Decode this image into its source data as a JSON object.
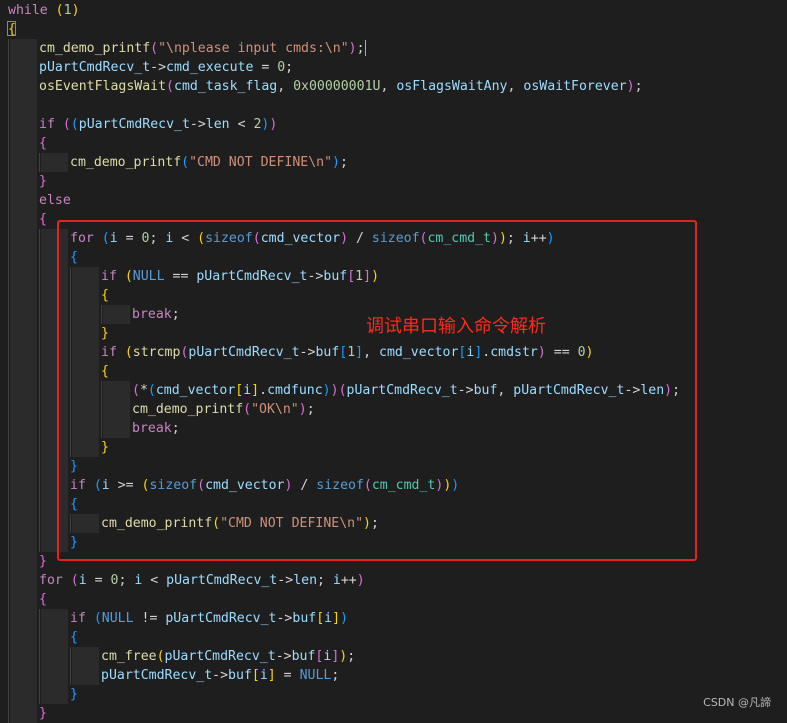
{
  "editor": {
    "lines": [
      {
        "indent": 0,
        "tokens": [
          [
            "kw",
            "while"
          ],
          [
            "pn",
            " "
          ],
          [
            "b1",
            "("
          ],
          [
            "num",
            "1"
          ],
          [
            "b1",
            ")"
          ]
        ]
      },
      {
        "indent": 0,
        "tokens": [
          [
            "b1",
            "{"
          ]
        ]
      },
      {
        "indent": 1,
        "cursor": true,
        "tokens": [
          [
            "fn",
            "cm_demo_printf"
          ],
          [
            "b2",
            "("
          ],
          [
            "str",
            "\"\\nplease input cmds:\\n\""
          ],
          [
            "b2",
            ")"
          ],
          [
            "pn",
            ";"
          ]
        ]
      },
      {
        "indent": 1,
        "tokens": [
          [
            "var",
            "pUartCmdRecv_t"
          ],
          [
            "pn",
            "->"
          ],
          [
            "var",
            "cmd_execute"
          ],
          [
            "pn",
            " = "
          ],
          [
            "num",
            "0"
          ],
          [
            "pn",
            ";"
          ]
        ]
      },
      {
        "indent": 1,
        "tokens": [
          [
            "fn",
            "osEventFlagsWait"
          ],
          [
            "b2",
            "("
          ],
          [
            "var",
            "cmd_task_flag"
          ],
          [
            "pn",
            ", "
          ],
          [
            "num",
            "0x00000001U"
          ],
          [
            "pn",
            ", "
          ],
          [
            "var",
            "osFlagsWaitAny"
          ],
          [
            "pn",
            ", "
          ],
          [
            "var",
            "osWaitForever"
          ],
          [
            "b2",
            ")"
          ],
          [
            "pn",
            ";"
          ]
        ]
      },
      {
        "indent": 1,
        "tokens": []
      },
      {
        "indent": 1,
        "tokens": [
          [
            "kw",
            "if"
          ],
          [
            "pn",
            " "
          ],
          [
            "b2",
            "("
          ],
          [
            "b3",
            "("
          ],
          [
            "var",
            "pUartCmdRecv_t"
          ],
          [
            "pn",
            "->"
          ],
          [
            "var",
            "len"
          ],
          [
            "pn",
            " < "
          ],
          [
            "num",
            "2"
          ],
          [
            "b3",
            ")"
          ],
          [
            "b2",
            ")"
          ]
        ]
      },
      {
        "indent": 1,
        "tokens": [
          [
            "b2",
            "{"
          ]
        ]
      },
      {
        "indent": 2,
        "tokens": [
          [
            "fn",
            "cm_demo_printf"
          ],
          [
            "b3",
            "("
          ],
          [
            "str",
            "\"CMD NOT DEFINE\\n\""
          ],
          [
            "b3",
            ")"
          ],
          [
            "pn",
            ";"
          ]
        ]
      },
      {
        "indent": 1,
        "tokens": [
          [
            "b2",
            "}"
          ]
        ]
      },
      {
        "indent": 1,
        "tokens": [
          [
            "kw",
            "else"
          ]
        ]
      },
      {
        "indent": 1,
        "tokens": [
          [
            "b2",
            "{"
          ]
        ]
      },
      {
        "indent": 2,
        "tokens": [
          [
            "kw",
            "for"
          ],
          [
            "pn",
            " "
          ],
          [
            "b3",
            "("
          ],
          [
            "var",
            "i"
          ],
          [
            "pn",
            " = "
          ],
          [
            "num",
            "0"
          ],
          [
            "pn",
            "; "
          ],
          [
            "var",
            "i"
          ],
          [
            "pn",
            " < "
          ],
          [
            "b1",
            "("
          ],
          [
            "cst",
            "sizeof"
          ],
          [
            "b2",
            "("
          ],
          [
            "var",
            "cmd_vector"
          ],
          [
            "b2",
            ")"
          ],
          [
            "pn",
            " / "
          ],
          [
            "cst",
            "sizeof"
          ],
          [
            "b2",
            "("
          ],
          [
            "typ",
            "cm_cmd_t"
          ],
          [
            "b2",
            ")"
          ],
          [
            "b1",
            ")"
          ],
          [
            "pn",
            "; "
          ],
          [
            "var",
            "i"
          ],
          [
            "pn",
            "++"
          ],
          [
            "b3",
            ")"
          ]
        ]
      },
      {
        "indent": 2,
        "tokens": [
          [
            "b3",
            "{"
          ]
        ]
      },
      {
        "indent": 3,
        "tokens": [
          [
            "kw",
            "if"
          ],
          [
            "pn",
            " "
          ],
          [
            "b1",
            "("
          ],
          [
            "cst",
            "NULL"
          ],
          [
            "pn",
            " == "
          ],
          [
            "var",
            "pUartCmdRecv_t"
          ],
          [
            "pn",
            "->"
          ],
          [
            "var",
            "buf"
          ],
          [
            "b2",
            "["
          ],
          [
            "num",
            "1"
          ],
          [
            "b2",
            "]"
          ],
          [
            "b1",
            ")"
          ]
        ]
      },
      {
        "indent": 3,
        "tokens": [
          [
            "b1",
            "{"
          ]
        ]
      },
      {
        "indent": 4,
        "tokens": [
          [
            "kw",
            "break"
          ],
          [
            "pn",
            ";"
          ]
        ]
      },
      {
        "indent": 3,
        "tokens": [
          [
            "b1",
            "}"
          ]
        ]
      },
      {
        "indent": 3,
        "tokens": [
          [
            "kw",
            "if"
          ],
          [
            "pn",
            " "
          ],
          [
            "b1",
            "("
          ],
          [
            "fn",
            "strcmp"
          ],
          [
            "b2",
            "("
          ],
          [
            "var",
            "pUartCmdRecv_t"
          ],
          [
            "pn",
            "->"
          ],
          [
            "var",
            "buf"
          ],
          [
            "b3",
            "["
          ],
          [
            "num",
            "1"
          ],
          [
            "b3",
            "]"
          ],
          [
            "pn",
            ", "
          ],
          [
            "var",
            "cmd_vector"
          ],
          [
            "b3",
            "["
          ],
          [
            "var",
            "i"
          ],
          [
            "b3",
            "]"
          ],
          [
            "pn",
            "."
          ],
          [
            "var",
            "cmdstr"
          ],
          [
            "b2",
            ")"
          ],
          [
            "pn",
            " == "
          ],
          [
            "num",
            "0"
          ],
          [
            "b1",
            ")"
          ]
        ]
      },
      {
        "indent": 3,
        "tokens": [
          [
            "b1",
            "{"
          ]
        ]
      },
      {
        "indent": 4,
        "tokens": [
          [
            "b2",
            "("
          ],
          [
            "pn",
            "*"
          ],
          [
            "b3",
            "("
          ],
          [
            "var",
            "cmd_vector"
          ],
          [
            "b1",
            "["
          ],
          [
            "var",
            "i"
          ],
          [
            "b1",
            "]"
          ],
          [
            "pn",
            "."
          ],
          [
            "var",
            "cmdfunc"
          ],
          [
            "b3",
            ")"
          ],
          [
            "b2",
            ")"
          ],
          [
            "b2",
            "("
          ],
          [
            "var",
            "pUartCmdRecv_t"
          ],
          [
            "pn",
            "->"
          ],
          [
            "var",
            "buf"
          ],
          [
            "pn",
            ", "
          ],
          [
            "var",
            "pUartCmdRecv_t"
          ],
          [
            "pn",
            "->"
          ],
          [
            "var",
            "len"
          ],
          [
            "b2",
            ")"
          ],
          [
            "pn",
            ";"
          ]
        ]
      },
      {
        "indent": 4,
        "tokens": [
          [
            "fn",
            "cm_demo_printf"
          ],
          [
            "b2",
            "("
          ],
          [
            "str",
            "\"OK\\n\""
          ],
          [
            "b2",
            ")"
          ],
          [
            "pn",
            ";"
          ]
        ]
      },
      {
        "indent": 4,
        "tokens": [
          [
            "kw",
            "break"
          ],
          [
            "pn",
            ";"
          ]
        ]
      },
      {
        "indent": 3,
        "tokens": [
          [
            "b1",
            "}"
          ]
        ]
      },
      {
        "indent": 2,
        "tokens": [
          [
            "b3",
            "}"
          ]
        ]
      },
      {
        "indent": 2,
        "tokens": [
          [
            "kw",
            "if"
          ],
          [
            "pn",
            " "
          ],
          [
            "b3",
            "("
          ],
          [
            "var",
            "i"
          ],
          [
            "pn",
            " >= "
          ],
          [
            "b1",
            "("
          ],
          [
            "cst",
            "sizeof"
          ],
          [
            "b2",
            "("
          ],
          [
            "var",
            "cmd_vector"
          ],
          [
            "b2",
            ")"
          ],
          [
            "pn",
            " / "
          ],
          [
            "cst",
            "sizeof"
          ],
          [
            "b2",
            "("
          ],
          [
            "typ",
            "cm_cmd_t"
          ],
          [
            "b2",
            ")"
          ],
          [
            "b1",
            ")"
          ],
          [
            "b3",
            ")"
          ]
        ]
      },
      {
        "indent": 2,
        "tokens": [
          [
            "b3",
            "{"
          ]
        ]
      },
      {
        "indent": 3,
        "tokens": [
          [
            "fn",
            "cm_demo_printf"
          ],
          [
            "b1",
            "("
          ],
          [
            "str",
            "\"CMD NOT DEFINE\\n\""
          ],
          [
            "b1",
            ")"
          ],
          [
            "pn",
            ";"
          ]
        ]
      },
      {
        "indent": 2,
        "tokens": [
          [
            "b3",
            "}"
          ]
        ]
      },
      {
        "indent": 1,
        "tokens": [
          [
            "b2",
            "}"
          ]
        ]
      },
      {
        "indent": 1,
        "tokens": [
          [
            "kw",
            "for"
          ],
          [
            "pn",
            " "
          ],
          [
            "b2",
            "("
          ],
          [
            "var",
            "i"
          ],
          [
            "pn",
            " = "
          ],
          [
            "num",
            "0"
          ],
          [
            "pn",
            "; "
          ],
          [
            "var",
            "i"
          ],
          [
            "pn",
            " < "
          ],
          [
            "var",
            "pUartCmdRecv_t"
          ],
          [
            "pn",
            "->"
          ],
          [
            "var",
            "len"
          ],
          [
            "pn",
            "; "
          ],
          [
            "var",
            "i"
          ],
          [
            "pn",
            "++"
          ],
          [
            "b2",
            ")"
          ]
        ]
      },
      {
        "indent": 1,
        "tokens": [
          [
            "b2",
            "{"
          ]
        ]
      },
      {
        "indent": 2,
        "tokens": [
          [
            "kw",
            "if"
          ],
          [
            "pn",
            " "
          ],
          [
            "b3",
            "("
          ],
          [
            "cst",
            "NULL"
          ],
          [
            "pn",
            " != "
          ],
          [
            "var",
            "pUartCmdRecv_t"
          ],
          [
            "pn",
            "->"
          ],
          [
            "var",
            "buf"
          ],
          [
            "b1",
            "["
          ],
          [
            "var",
            "i"
          ],
          [
            "b1",
            "]"
          ],
          [
            "b3",
            ")"
          ]
        ]
      },
      {
        "indent": 2,
        "tokens": [
          [
            "b3",
            "{"
          ]
        ]
      },
      {
        "indent": 3,
        "tokens": [
          [
            "fn",
            "cm_free"
          ],
          [
            "b1",
            "("
          ],
          [
            "var",
            "pUartCmdRecv_t"
          ],
          [
            "pn",
            "->"
          ],
          [
            "var",
            "buf"
          ],
          [
            "b2",
            "["
          ],
          [
            "var",
            "i"
          ],
          [
            "b2",
            "]"
          ],
          [
            "b1",
            ")"
          ],
          [
            "pn",
            ";"
          ]
        ]
      },
      {
        "indent": 3,
        "tokens": [
          [
            "var",
            "pUartCmdRecv_t"
          ],
          [
            "pn",
            "->"
          ],
          [
            "var",
            "buf"
          ],
          [
            "b1",
            "["
          ],
          [
            "var",
            "i"
          ],
          [
            "b1",
            "]"
          ],
          [
            "pn",
            " = "
          ],
          [
            "cst",
            "NULL"
          ],
          [
            "pn",
            ";"
          ]
        ]
      },
      {
        "indent": 2,
        "tokens": [
          [
            "b3",
            "}"
          ]
        ]
      },
      {
        "indent": 1,
        "tokens": [
          [
            "b2",
            "}"
          ]
        ]
      }
    ]
  },
  "annotation": {
    "text": "调试串口输入命令解析",
    "color": "#ff2a1a"
  },
  "watermark": {
    "text": "CSDN @凡諦"
  },
  "theme": {
    "background": "#1e1e1e",
    "keyword": "#c586c0",
    "function": "#dcdcaa",
    "variable": "#9cdcfe",
    "string": "#ce9178",
    "number": "#b5cea8",
    "type": "#4ec9b0",
    "constant": "#569cd6",
    "highlight_box": "#e6211e"
  }
}
